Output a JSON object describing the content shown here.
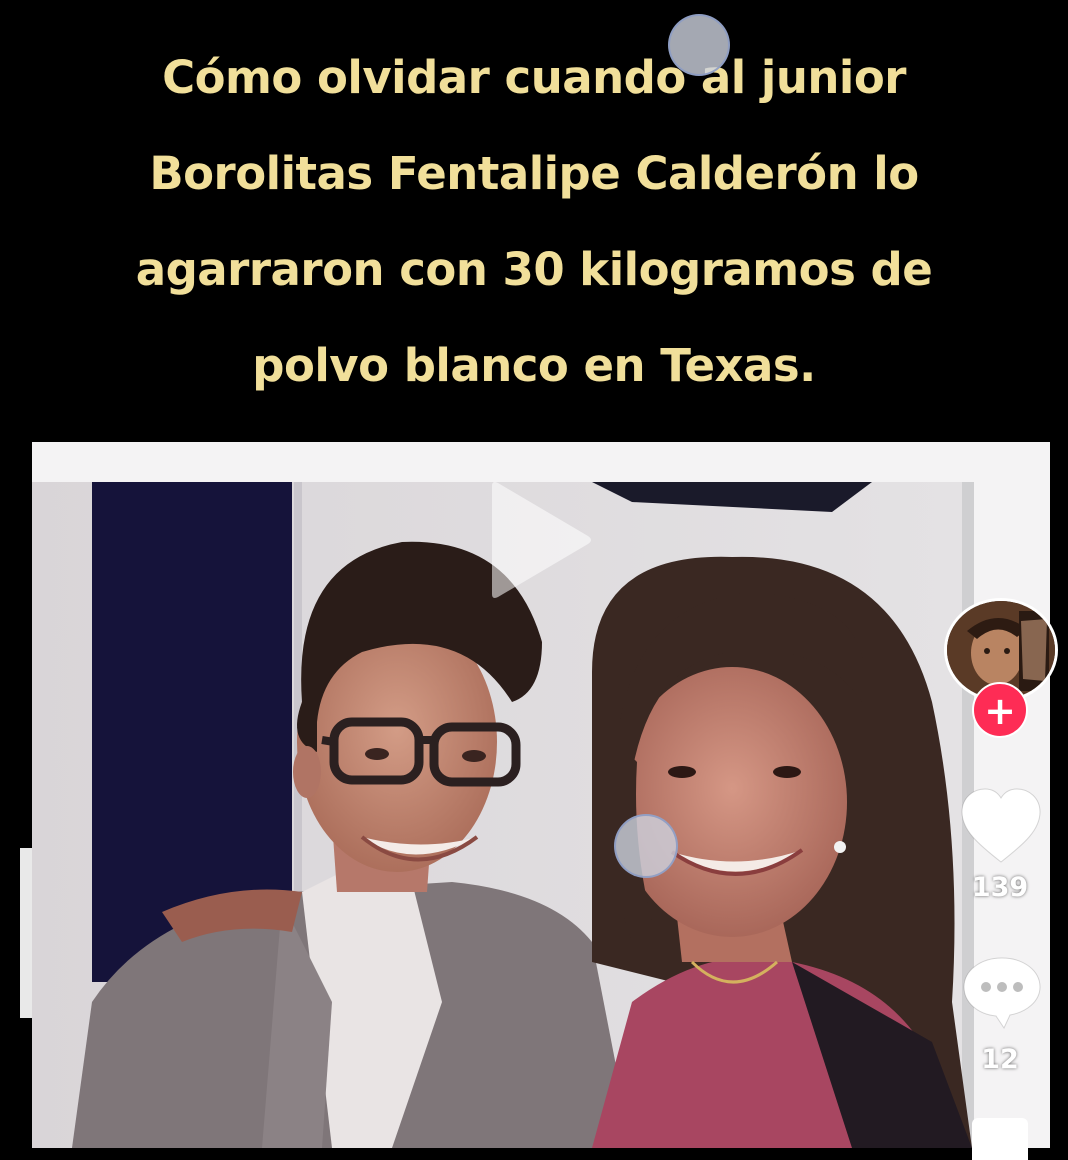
{
  "caption": {
    "lines": [
      "Cómo olvidar cuando al junior",
      "Borolitas Fentalipe Calderón lo",
      "agarraron con 30 kilogramos de",
      "polvo blanco en Texas."
    ]
  },
  "video": {
    "play_icon": "play-icon",
    "content": "photo of a young man with glasses and a woman smiling"
  },
  "actions": {
    "avatar_icon": "user-avatar",
    "follow_label": "+",
    "like_icon": "heart-icon",
    "like_count": "139",
    "comment_icon": "comment-bubble-icon",
    "comment_count": "12"
  },
  "colors": {
    "background": "#000000",
    "caption_text": "#f1df9a",
    "follow_button": "#fe2c55",
    "icon_fill": "#ffffff"
  }
}
